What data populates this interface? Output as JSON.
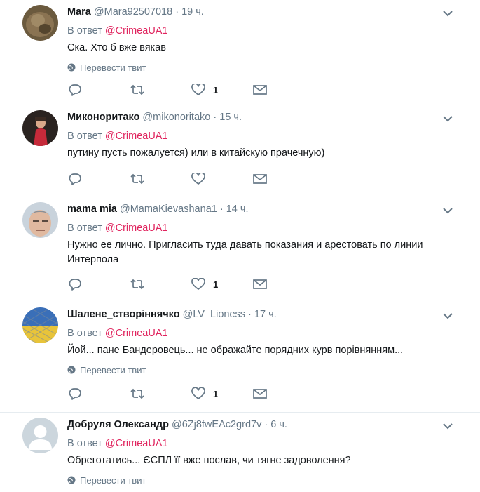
{
  "translate_label": "Перевести твит",
  "reply_prefix": "В ответ",
  "tweets": [
    {
      "name": "Mara",
      "handle": "@Mara92507018",
      "time": "19 ч.",
      "reply_to": "@CrimeaUA1",
      "text": "Ска. Хто б вже вякав",
      "likes": "1"
    },
    {
      "name": "Миконоритако",
      "handle": "@mikonoritako",
      "time": "15 ч.",
      "reply_to": "@CrimeaUA1",
      "text": "путину пусть пожалуется) или в китайскую прачечную)",
      "likes": ""
    },
    {
      "name": "mama mia",
      "handle": "@MamaKievashana1",
      "time": "14 ч.",
      "reply_to": "@CrimeaUA1",
      "text": "Нужно ее лично. Пригласить туда давать показания и арестовать по линии Интерпола",
      "likes": "1"
    },
    {
      "name": "Шалене_створіннячко",
      "handle": "@LV_Lioness",
      "time": "17 ч.",
      "reply_to": "@CrimeaUA1",
      "text": "Йой... пане Бандеровець... не ображайте порядних курв порівнянням...",
      "likes": "1"
    },
    {
      "name": "Добруля Олександр",
      "handle": "@6Zj8fwEAc2grd7v",
      "time": "6 ч.",
      "reply_to": "@CrimeaUA1",
      "text": "Обреготатись... ЄСПЛ її вже послав, чи тягне задоволення?",
      "likes": ""
    }
  ]
}
